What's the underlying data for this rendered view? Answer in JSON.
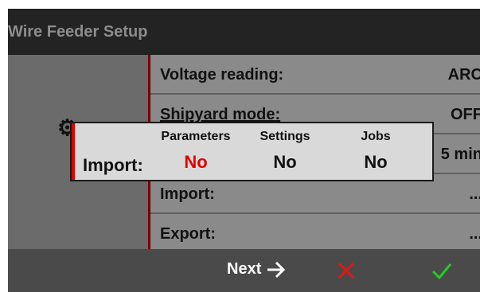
{
  "window": {
    "title": "Wire Feeder Setup"
  },
  "menu": {
    "rows": [
      {
        "label": "Voltage reading:",
        "value": "ARC"
      },
      {
        "label": "Shipyard mode:",
        "value": "OFF"
      },
      {
        "label": "",
        "value": "5 min"
      },
      {
        "label": "Import:",
        "value": "..."
      },
      {
        "label": "Export:",
        "value": "..."
      }
    ]
  },
  "dialog": {
    "import_label": "Import:",
    "options": [
      {
        "header": "Parameters",
        "value": "No"
      },
      {
        "header": "Settings",
        "value": "No"
      },
      {
        "header": "Jobs",
        "value": "No"
      }
    ]
  },
  "bottom": {
    "next_label": "Next"
  },
  "colors": {
    "accent_red": "#e00000",
    "confirm_green": "#22cc22",
    "cancel_red": "#ee1111"
  },
  "icons": {
    "gear": "gear-icon",
    "next": "arrow-right-icon",
    "cancel": "close-icon",
    "confirm": "check-icon"
  }
}
